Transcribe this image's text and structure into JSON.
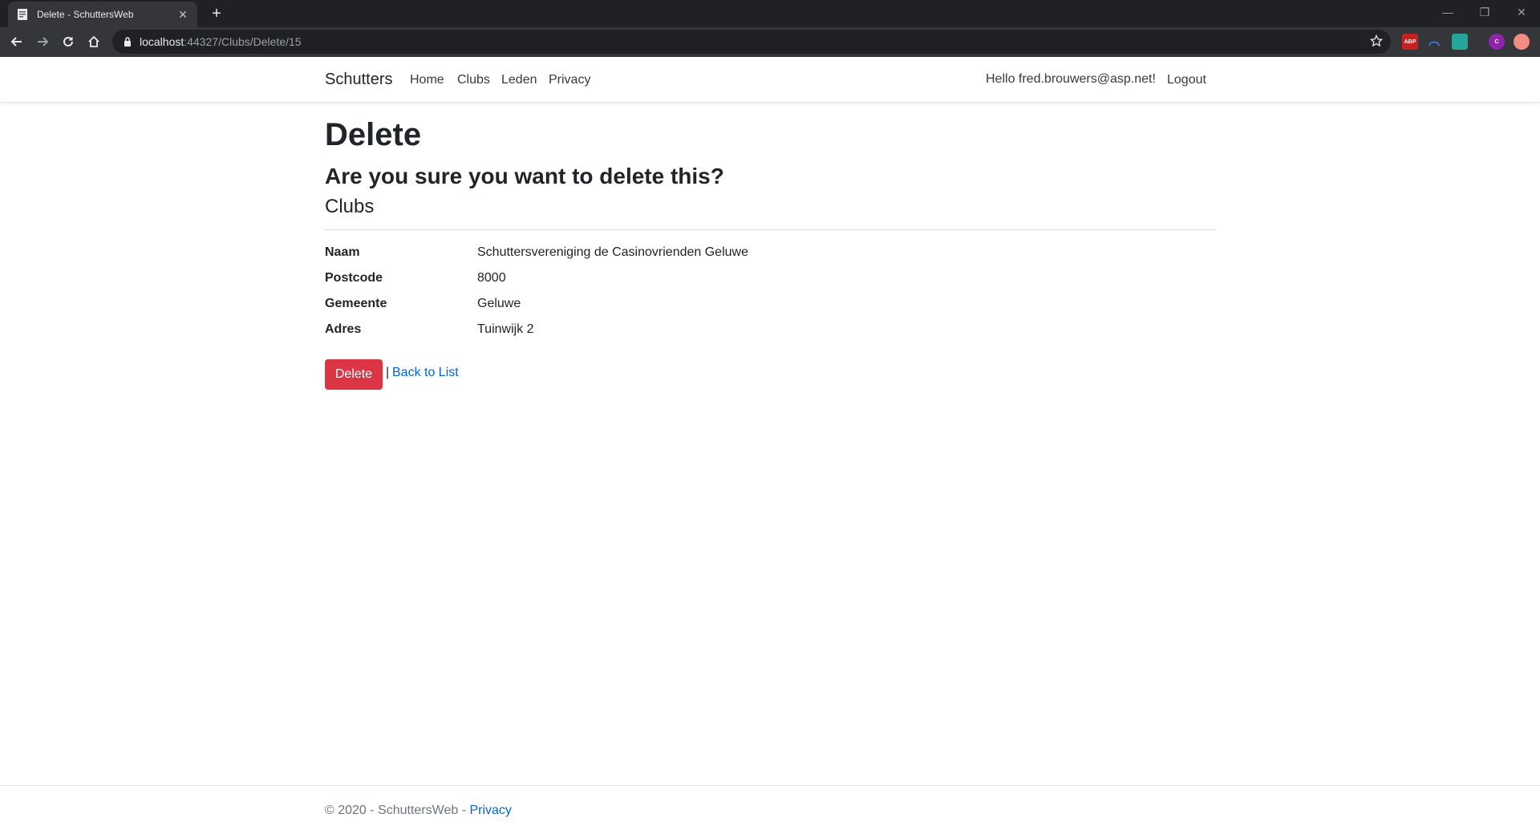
{
  "browser": {
    "tab_title": "Delete - SchuttersWeb",
    "url_host": "localhost",
    "url_path": ":44327/Clubs/Delete/15"
  },
  "nav": {
    "brand": "Schutters",
    "links": [
      "Home",
      "Clubs",
      "Leden",
      "Privacy"
    ],
    "hello": "Hello fred.brouwers@asp.net!",
    "logout": "Logout"
  },
  "page": {
    "title": "Delete",
    "question": "Are you sure you want to delete this?",
    "entity": "Clubs",
    "fields": [
      {
        "label": "Naam",
        "value": "Schuttersvereniging de Casinovrienden Geluwe"
      },
      {
        "label": "Postcode",
        "value": "8000"
      },
      {
        "label": "Gemeente",
        "value": "Geluwe"
      },
      {
        "label": "Adres",
        "value": "Tuinwijk 2"
      }
    ],
    "delete_label": "Delete",
    "separator": "|",
    "back_label": "Back to List"
  },
  "footer": {
    "copyright": "© 2020 - SchuttersWeb - ",
    "privacy": "Privacy"
  },
  "colors": {
    "danger": "#dc3545",
    "link": "#0366d6"
  }
}
